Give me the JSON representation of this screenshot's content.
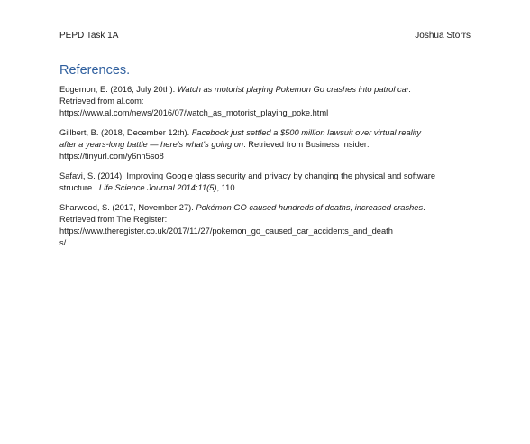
{
  "header": {
    "left": "PEPD Task 1A",
    "right": "Joshua Storrs"
  },
  "title": "References.",
  "references": [
    {
      "lines": [
        {
          "plain": "Edgemon, E. (2016, July 20th). ",
          "italic": "Watch as motorist playing Pokemon Go crashes into patrol car.",
          "tail": ""
        },
        {
          "plain": "Retrieved from al.com:",
          "italic": "",
          "tail": ""
        },
        {
          "plain": "https://www.al.com/news/2016/07/watch_as_motorist_playing_poke.html",
          "italic": "",
          "tail": ""
        }
      ]
    },
    {
      "lines": [
        {
          "plain": "Gillbert, B. (2018, December 12th). ",
          "italic": "Facebook just settled a $500 million lawsuit over virtual reality",
          "tail": ""
        },
        {
          "plain": "",
          "italic": "after a years-long battle — here's what's going on",
          "tail": ". Retrieved from Business Insider:"
        },
        {
          "plain": "https://tinyurl.com/y6nn5so8",
          "italic": "",
          "tail": ""
        }
      ]
    },
    {
      "lines": [
        {
          "plain": "Safavi, S. (2014). Improving Google glass security and privacy by changing the physical and software",
          "italic": "",
          "tail": ""
        },
        {
          "plain": "structure . ",
          "italic": "Life Science Journal 2014;11(5)",
          "tail": ", 110."
        }
      ]
    },
    {
      "lines": [
        {
          "plain": "Sharwood, S. (2017, November 27). ",
          "italic": "Pokémon GO caused hundreds of deaths, increased crashes",
          "tail": "."
        },
        {
          "plain": "Retrieved from The Register:",
          "italic": "",
          "tail": ""
        },
        {
          "plain": "https://www.theregister.co.uk/2017/11/27/pokemon_go_caused_car_accidents_and_death",
          "italic": "",
          "tail": ""
        },
        {
          "plain": "s/",
          "italic": "",
          "tail": ""
        }
      ]
    }
  ]
}
